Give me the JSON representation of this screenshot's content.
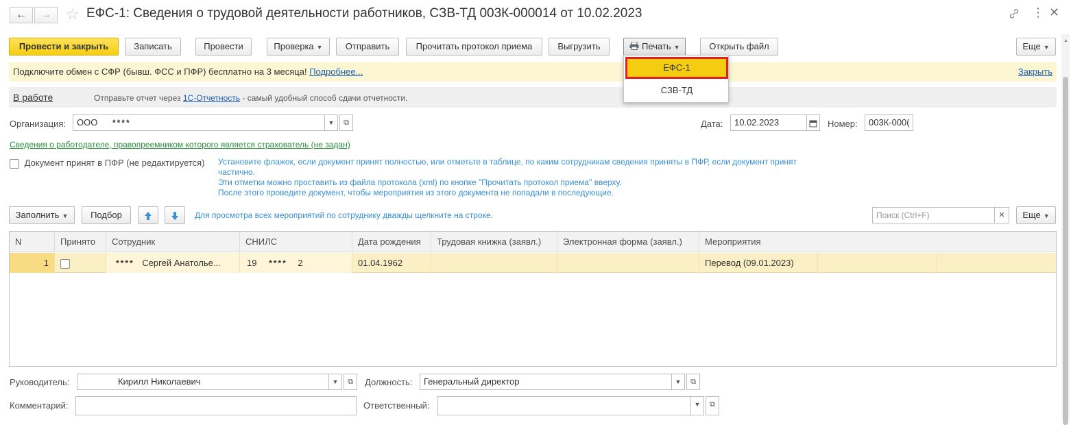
{
  "window": {
    "title": "ЕФС-1: Сведения о трудовой деятельности работников, СЗВ-ТД 003К-000014 от 10.02.2023"
  },
  "toolbar": {
    "post_close": "Провести и закрыть",
    "save": "Записать",
    "post": "Провести",
    "check": "Проверка",
    "send": "Отправить",
    "read_protocol": "Прочитать протокол приема",
    "export": "Выгрузить",
    "print": "Печать",
    "open_file": "Открыть файл",
    "more": "Еще"
  },
  "print_menu": {
    "items": [
      "ЕФС-1",
      "СЗВ-ТД"
    ]
  },
  "banner": {
    "text": "Подключите обмен с СФР (бывш. ФСС и ПФР) бесплатно на 3 месяца!",
    "more_link": "Подробнее...",
    "close_link": "Закрыть"
  },
  "status": {
    "state": "В работе",
    "text_before": "Отправьте отчет через",
    "link": "1С-Отчетность",
    "text_after": "- самый удобный способ сдачи отчетности."
  },
  "form": {
    "org_label": "Организация:",
    "org_value": "ООО",
    "org_mask": "****",
    "date_label": "Дата:",
    "date_value": "10.02.2023",
    "number_label": "Номер:",
    "number_value": "003К-000(",
    "employer_link": "Сведения о работодателе, правопреемником которого является страхователь (не задан)",
    "accepted_label": "Документ принят в ПФР (не редактируется)",
    "hint_lines": [
      "Установите флажок, если документ принят полностью, или отметьте в таблице, по каким сотрудникам сведения приняты в ПФР, если документ принят",
      "частично.",
      "Эти отметки можно проставить из файла протокола (xml) по кнопке \"Прочитать протокол приема\" вверху.",
      "После этого проведите документ, чтобы мероприятия из этого документа не попадали в последующие."
    ]
  },
  "table_toolbar": {
    "fill": "Заполнить",
    "select": "Подбор",
    "hint": "Для просмотра всех мероприятий по сотруднику дважды щелкните на строке.",
    "search_placeholder": "Поиск (Ctrl+F)",
    "more": "Еще"
  },
  "table": {
    "columns": [
      "N",
      "Принято",
      "Сотрудник",
      "СНИЛС",
      "Дата рождения",
      "Трудовая книжка (заявл.)",
      "Электронная форма (заявл.)",
      "Мероприятия"
    ],
    "rows": [
      {
        "n": "1",
        "employee_mask": "****",
        "employee": "Сергей Анатолье...",
        "snils_start": "19",
        "snils_mask": "****",
        "snils_end": "2",
        "birth_date": "01.04.1962",
        "work_book": "",
        "electronic_form": "",
        "events": "Перевод (09.01.2023)"
      }
    ]
  },
  "footer": {
    "head_label": "Руководитель:",
    "head_value": "Кирилл Николаевич",
    "position_label": "Должность:",
    "position_value": "Генеральный директор",
    "comment_label": "Комментарий:",
    "responsible_label": "Ответственный:"
  },
  "colors": {
    "primary_button": "#f5cd10",
    "banner_bg": "#fdf6d3",
    "selected_row": "#fbf0c5",
    "menu_highlight": "#f5cd10",
    "menu_border": "#e32020"
  }
}
